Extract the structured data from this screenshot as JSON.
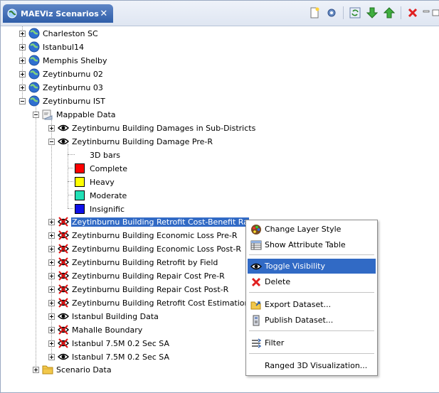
{
  "tab": {
    "title": "MAEViz Scenarios",
    "close": "✕"
  },
  "toolbar": [
    "new-icon",
    "settings-icon",
    "refresh-icon",
    "move-down-icon",
    "move-up-icon",
    "remove-icon",
    "minimize-icon",
    "maximize-icon"
  ],
  "tree": {
    "scenarios": [
      {
        "label": "Charleston SC"
      },
      {
        "label": "Istanbul14"
      },
      {
        "label": "Memphis Shelby"
      },
      {
        "label": "Zeytinburnu 02"
      },
      {
        "label": "Zeytinburnu 03"
      },
      {
        "label": "Zeytinburnu IST"
      }
    ],
    "mappable": "Mappable Data",
    "layers_before": [
      {
        "label": "Zeytinburnu Building Damages in Sub-Districts",
        "visible": true
      },
      {
        "label": "Zeytinburnu Building Damage Pre-R",
        "visible": true
      }
    ],
    "legend": {
      "title": "3D bars",
      "items": [
        {
          "label": "Complete",
          "color": "#ff0000"
        },
        {
          "label": "Heavy",
          "color": "#ffff00"
        },
        {
          "label": "Moderate",
          "color": "#21e0b6"
        },
        {
          "label": "Insignific",
          "color": "#1010e8"
        }
      ]
    },
    "layers_after": [
      {
        "label": "Zeytinburnu Building Retrofit Cost-Benefit Ra",
        "visible": false,
        "selected": true
      },
      {
        "label": "Zeytinburnu Building Economic Loss Pre-R",
        "visible": false
      },
      {
        "label": "Zeytinburnu Building Economic Loss Post-R",
        "visible": false
      },
      {
        "label": "Zeytinburnu Building Retrofit by Field",
        "visible": false
      },
      {
        "label": "Zeytinburnu Building Repair Cost Pre-R",
        "visible": false
      },
      {
        "label": "Zeytinburnu Building Repair Cost Post-R",
        "visible": false
      },
      {
        "label": "Zeytinburnu Building Retrofit Cost Estimation",
        "visible": false
      },
      {
        "label": "Istanbul Building Data",
        "visible": true
      },
      {
        "label": "Mahalle Boundary",
        "visible": false
      },
      {
        "label": "Istanbul 7.5M 0.2 Sec SA",
        "visible": false
      },
      {
        "label": "Istanbul 7.5M 0.2 Sec SA",
        "visible": true
      }
    ],
    "scenario_data": "Scenario Data"
  },
  "context_menu": {
    "items": [
      {
        "label": "Change Layer Style",
        "icon": "palette-icon"
      },
      {
        "label": "Show Attribute Table",
        "icon": "table-icon"
      },
      {
        "label": "Toggle Visibility",
        "icon": "eye-icon",
        "highlighted": true
      },
      {
        "label": "Delete",
        "icon": "delete-icon"
      },
      {
        "label": "Export Dataset...",
        "icon": "export-icon"
      },
      {
        "label": "Publish Dataset...",
        "icon": "publish-icon"
      },
      {
        "label": "Filter",
        "icon": "filter-icon"
      },
      {
        "label": "Ranged 3D Visualization...",
        "icon": ""
      }
    ]
  }
}
